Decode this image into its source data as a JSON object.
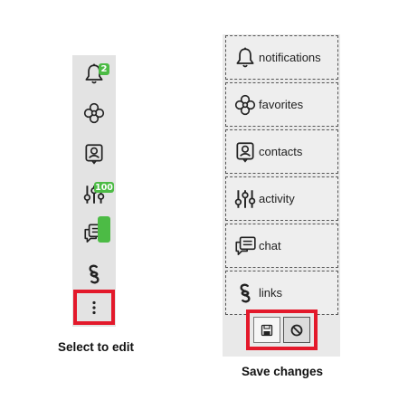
{
  "collapsed_sidebar": {
    "items": [
      {
        "icon": "bell-icon",
        "badge": "2"
      },
      {
        "icon": "clover-icon"
      },
      {
        "icon": "contact-card-icon"
      },
      {
        "icon": "sliders-icon",
        "badge": "100"
      },
      {
        "icon": "chat-icon",
        "badge": ""
      },
      {
        "icon": "link-icon"
      }
    ],
    "more_icon": "vertical-dots-icon",
    "caption": "Select to edit"
  },
  "expanded_sidebar": {
    "items": [
      {
        "label": "notifications",
        "icon": "bell-icon"
      },
      {
        "label": "favorites",
        "icon": "clover-icon"
      },
      {
        "label": "contacts",
        "icon": "contact-card-icon"
      },
      {
        "label": "activity",
        "icon": "sliders-icon"
      },
      {
        "label": "chat",
        "icon": "chat-icon"
      },
      {
        "label": "links",
        "icon": "link-icon"
      }
    ],
    "save_icon": "floppy-disk-icon",
    "cancel_icon": "prohibited-icon",
    "caption": "Save changes"
  },
  "colors": {
    "highlight": "#e3192b",
    "badge": "#4cbb45",
    "sidebar_bg": "#e3e3e3"
  }
}
